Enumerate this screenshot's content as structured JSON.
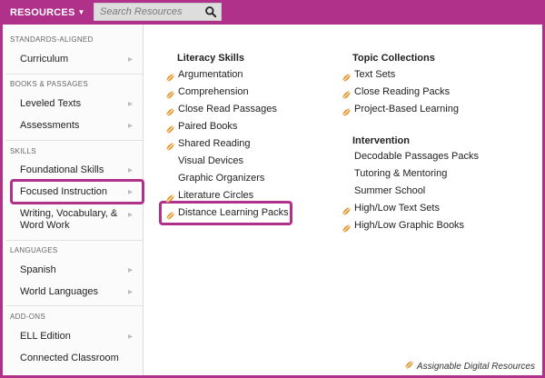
{
  "header": {
    "resources_label": "RESOURCES",
    "search_placeholder": "Search Resources"
  },
  "sidebar": {
    "sections": [
      {
        "title": "STANDARDS-ALIGNED",
        "items": [
          "Curriculum"
        ]
      },
      {
        "title": "BOOKS & PASSAGES",
        "items": [
          "Leveled Texts",
          "Assessments"
        ]
      },
      {
        "title": "SKILLS",
        "items": [
          "Foundational Skills",
          "Focused Instruction",
          "Writing, Vocabulary, &",
          "Word Work"
        ]
      },
      {
        "title": "LANGUAGES",
        "items": [
          "Spanish",
          "World Languages"
        ]
      },
      {
        "title": "ADD-ONS",
        "items": [
          "ELL Edition",
          "Connected Classroom"
        ]
      }
    ]
  },
  "literacy": {
    "title": "Literacy Skills",
    "items": [
      "Argumentation",
      "Comprehension",
      "Close Read Passages",
      "Paired Books",
      "Shared Reading",
      "Visual Devices",
      "Graphic Organizers",
      "Literature Circles",
      "Distance Learning Packs"
    ]
  },
  "topics": {
    "title": "Topic Collections",
    "items": [
      "Text Sets",
      "Close Reading Packs",
      "Project-Based Learning"
    ]
  },
  "intervention": {
    "title": "Intervention",
    "items": [
      "Decodable Passages Packs",
      "Tutoring & Mentoring",
      "Summer School",
      "High/Low Text Sets",
      "High/Low Graphic Books"
    ]
  },
  "footer": {
    "legend": "Assignable Digital Resources"
  },
  "colors": {
    "brand": "#b0318a",
    "icon": "#e8952b"
  },
  "icons": {
    "digital": "digital-resource-icon",
    "search": "search-icon"
  }
}
